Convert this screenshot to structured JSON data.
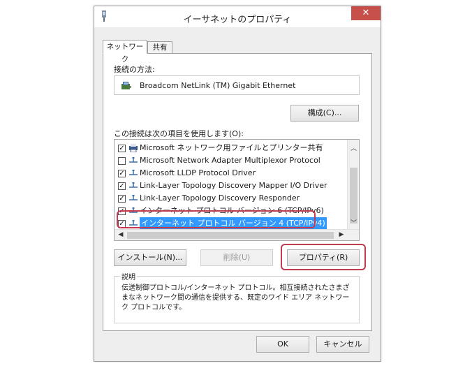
{
  "window": {
    "title": "イーサネットのプロパティ",
    "close_glyph": "✕"
  },
  "tabs": [
    {
      "label": "ネットワーク"
    },
    {
      "label": "共有"
    }
  ],
  "connect_using_label": "接続の方法:",
  "adapter_name": "Broadcom NetLink (TM) Gigabit Ethernet",
  "configure_button": "構成(C)...",
  "items_label": "この接続は次の項目を使用します(O):",
  "items": [
    {
      "label": "Microsoft ネットワーク用ファイルとプリンター共有",
      "checked": true,
      "icon": "printer-share-icon"
    },
    {
      "label": "Microsoft Network Adapter Multiplexor Protocol",
      "checked": false,
      "icon": "protocol-icon"
    },
    {
      "label": "Microsoft LLDP Protocol Driver",
      "checked": true,
      "icon": "protocol-icon"
    },
    {
      "label": "Link-Layer Topology Discovery Mapper I/O Driver",
      "checked": true,
      "icon": "protocol-icon"
    },
    {
      "label": "Link-Layer Topology Discovery Responder",
      "checked": true,
      "icon": "protocol-icon"
    },
    {
      "label": "インターネット プロトコル バージョン 6 (TCP/IPv6)",
      "checked": true,
      "icon": "protocol-icon"
    },
    {
      "label": "インターネット プロトコル バージョン 4 (TCP/IPv4)",
      "checked": true,
      "icon": "protocol-icon",
      "selected": true
    }
  ],
  "buttons": {
    "install": "インストール(N)...",
    "uninstall": "削除(U)",
    "properties": "プロパティ(R)",
    "ok": "OK",
    "cancel": "キャンセル"
  },
  "description": {
    "title": "説明",
    "text": "伝送制御プロトコル/インターネット プロトコル。相互接続されたさまざまなネットワーク間の通信を提供する、既定のワイド エリア ネットワーク プロトコルです。"
  },
  "colors": {
    "selection": "#3399ff",
    "highlight": "#c43a4f",
    "close": "#c74f4a"
  }
}
